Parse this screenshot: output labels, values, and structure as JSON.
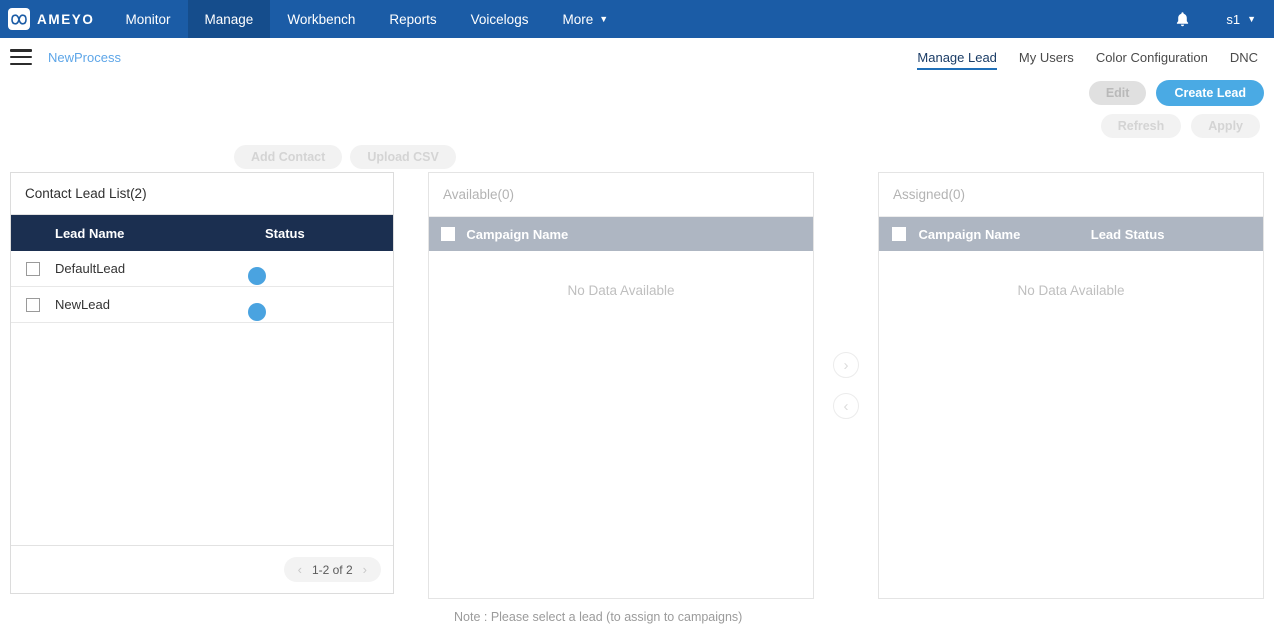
{
  "topnav": {
    "brand": "AMEYO",
    "brand_icon": "ameyo-infinity-logo",
    "items": [
      {
        "label": "Monitor",
        "active": false
      },
      {
        "label": "Manage",
        "active": true
      },
      {
        "label": "Workbench",
        "active": false
      },
      {
        "label": "Reports",
        "active": false
      },
      {
        "label": "Voicelogs",
        "active": false
      },
      {
        "label": "More",
        "active": false,
        "caret": "⌄"
      }
    ],
    "notification_icon": "bell-icon",
    "user": "s1",
    "user_caret": "⌄",
    "bg_color": "#1b5ca6",
    "active_bg_color": "#154d8c"
  },
  "subbar": {
    "menu_icon": "hamburger-menu-icon",
    "breadcrumb": "NewProcess",
    "breadcrumb_color": "#5ea6e8",
    "tabs": [
      {
        "label": "Manage Lead",
        "active": true
      },
      {
        "label": "My Users",
        "active": false
      },
      {
        "label": "Color Configuration",
        "active": false
      },
      {
        "label": "DNC",
        "active": false
      }
    ],
    "active_underline_color": "#1f6fb8"
  },
  "actions": {
    "edit_label": "Edit",
    "create_lead_label": "Create Lead",
    "refresh_label": "Refresh",
    "apply_label": "Apply",
    "add_contact_label": "Add Contact",
    "upload_csv_label": "Upload CSV",
    "primary_color": "#4aaae4",
    "disabled_color": "#e0e0e0"
  },
  "lead_panel": {
    "title": "Contact Lead List(2)",
    "header_bg": "#1b2f50",
    "columns": [
      "Lead Name",
      "Status"
    ],
    "rows": [
      {
        "name": "DefaultLead",
        "status_on": true,
        "checked": false
      },
      {
        "name": "NewLead",
        "status_on": true,
        "checked": false
      }
    ],
    "pagination": {
      "prev_icon": "‹",
      "text": "1-2 of 2",
      "next_icon": "›"
    },
    "toggle_track_color": "#a9d6f3",
    "toggle_knob_color": "#4aa3e0"
  },
  "available_panel": {
    "title": "Available(0)",
    "columns": [
      "Campaign Name"
    ],
    "empty_text": "No Data Available",
    "header_bg": "#aeb6c2"
  },
  "assigned_panel": {
    "title": "Assigned(0)",
    "columns": [
      "Campaign Name",
      "Lead Status"
    ],
    "empty_text": "No Data Available",
    "header_bg": "#aeb6c2"
  },
  "transfer_controls": {
    "assign_icon": "›",
    "unassign_icon": "‹"
  },
  "footer": {
    "note": "Note : Please select a lead (to assign to campaigns)"
  }
}
